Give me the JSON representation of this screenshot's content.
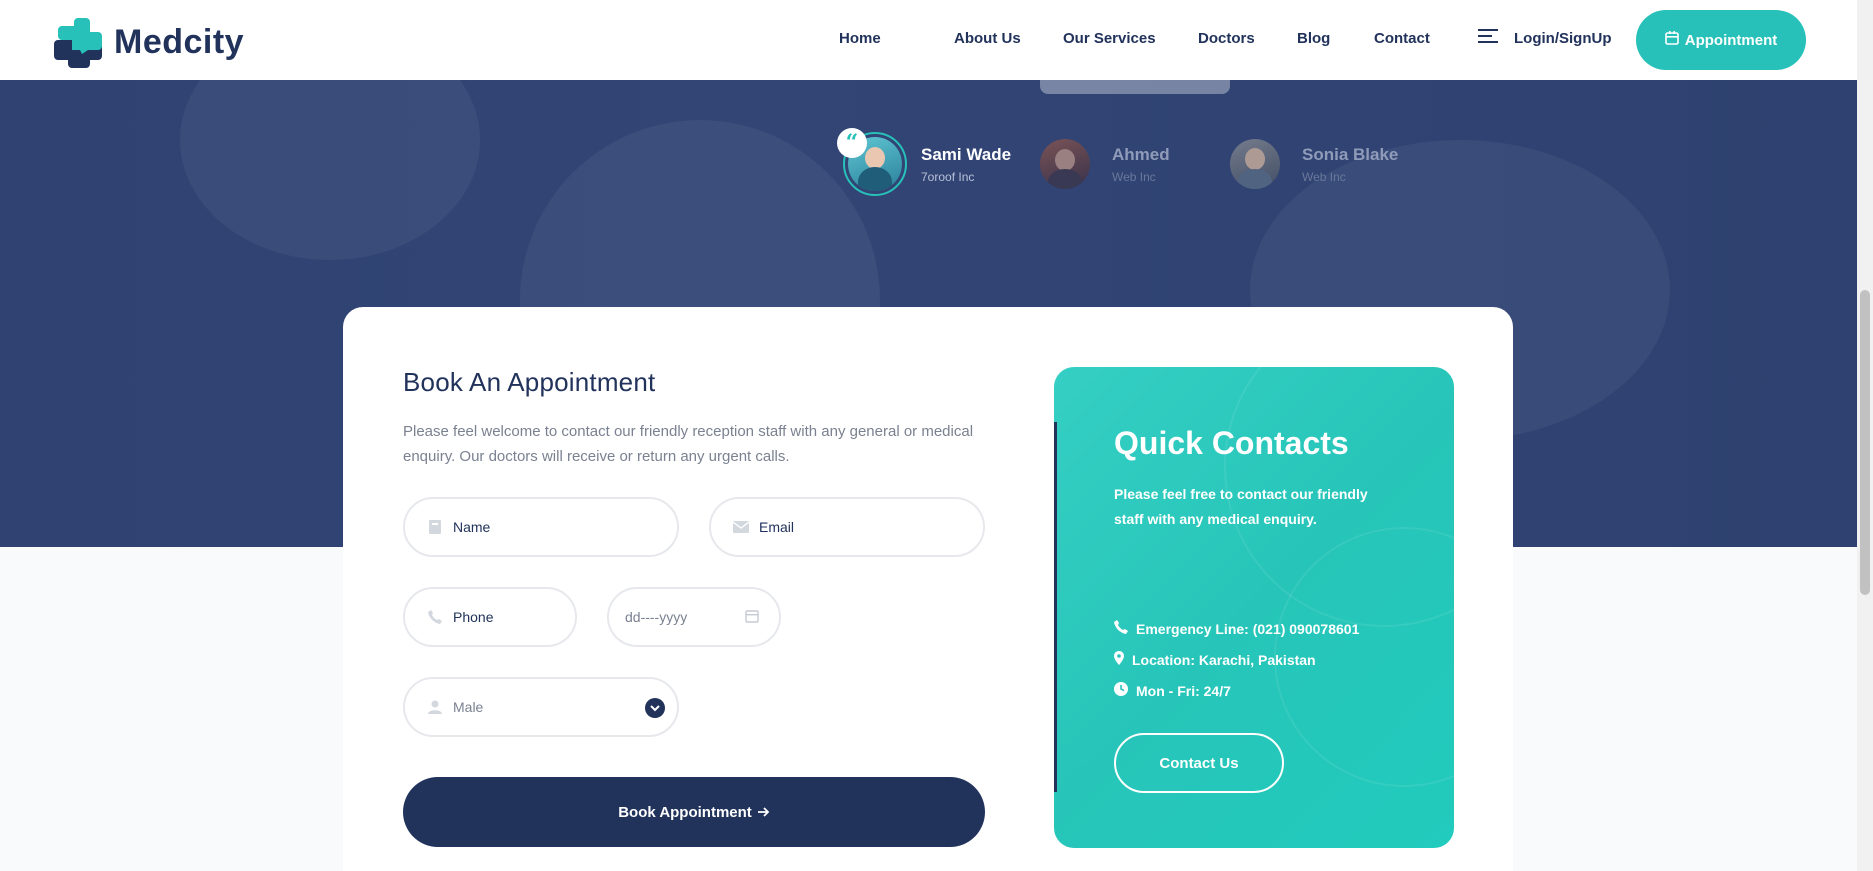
{
  "brand": {
    "name": "Medcity",
    "primary": "#21325b",
    "accent": "#27c1b9"
  },
  "nav": {
    "items": [
      "Home",
      "About Us",
      "Our Services",
      "Doctors",
      "Blog",
      "Contact"
    ],
    "login_label": "Login/SignUp",
    "appointment_label": "Appointment"
  },
  "testimonials": {
    "authors": [
      {
        "name": "Sami Wade",
        "org": "7oroof Inc",
        "active": true
      },
      {
        "name": "Ahmed",
        "org": "Web Inc",
        "active": false
      },
      {
        "name": "Sonia Blake",
        "org": "Web Inc",
        "active": false
      }
    ]
  },
  "appointment": {
    "title": "Book An Appointment",
    "description": "Please feel welcome to contact our friendly reception staff with any general or medical enquiry. Our doctors will receive or return any urgent calls.",
    "name_placeholder": "Name",
    "email_placeholder": "Email",
    "phone_placeholder": "Phone",
    "date_placeholder": "dd----yyyy",
    "gender_value": "Male",
    "submit_label": "Book Appointment"
  },
  "quick_contacts": {
    "title": "Quick Contacts",
    "description": "Please feel free to contact our friendly staff with any medical enquiry.",
    "emergency": "Emergency Line: (021) 090078601",
    "location": "Location: Karachi, Pakistan",
    "hours": "Mon - Fri: 24/7",
    "button_label": "Contact Us"
  }
}
